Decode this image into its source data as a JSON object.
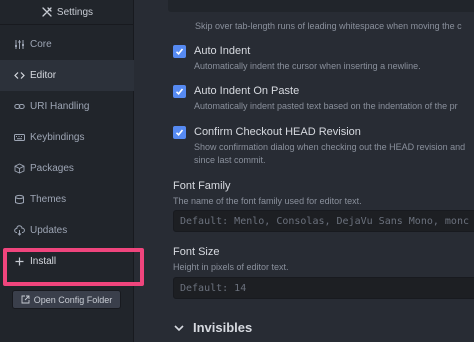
{
  "sidebar": {
    "header": {
      "title": "Settings",
      "icon": "tools-icon"
    },
    "items": [
      {
        "label": "Core",
        "icon": "sliders-icon"
      },
      {
        "label": "Editor",
        "icon": "code-icon",
        "active": true
      },
      {
        "label": "URI Handling",
        "icon": "link-icon"
      },
      {
        "label": "Keybindings",
        "icon": "keyboard-icon"
      },
      {
        "label": "Packages",
        "icon": "package-icon"
      },
      {
        "label": "Themes",
        "icon": "paintcan-icon"
      },
      {
        "label": "Updates",
        "icon": "cloud-download-icon"
      },
      {
        "label": "Install",
        "icon": "plus-icon",
        "highlighted": true
      }
    ],
    "open_config_label": "Open Config Folder"
  },
  "main": {
    "top_desc": "Skip over tab-length runs of leading whitespace when moving the c",
    "settings": [
      {
        "title": "Auto Indent",
        "checked": true,
        "desc": [
          "Automatically indent the cursor when inserting a newline."
        ]
      },
      {
        "title": "Auto Indent On Paste",
        "checked": true,
        "desc": [
          "Automatically indent pasted text based on the indentation of the pr"
        ]
      },
      {
        "title": "Confirm Checkout HEAD Revision",
        "checked": true,
        "desc": [
          "Show confirmation dialog when checking out the HEAD revision and",
          "since last commit."
        ]
      }
    ],
    "font_family": {
      "title": "Font Family",
      "desc": "The name of the font family used for editor text.",
      "placeholder": "Default: Menlo, Consolas, DejaVu Sans Mono, monc"
    },
    "font_size": {
      "title": "Font Size",
      "desc": "Height in pixels of editor text.",
      "placeholder": "Default: 14"
    },
    "section": {
      "title": "Invisibles",
      "icon": "chevron-down-icon"
    }
  },
  "colors": {
    "accent": "#568af2",
    "highlight": "#f0457d",
    "background": "#282c34",
    "sidebar": "#21252b"
  }
}
